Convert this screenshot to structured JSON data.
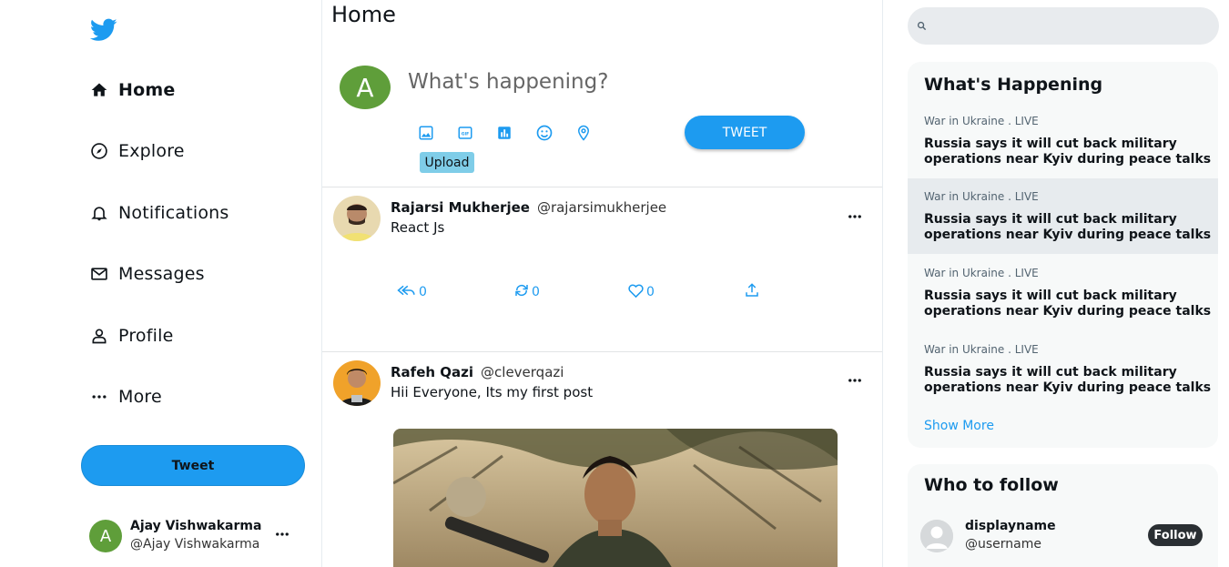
{
  "colors": {
    "accent": "#1d9bf0",
    "avatar_green": "#5f9e3a",
    "upload": "#7fcde8",
    "follow_btn": "#2a2f33"
  },
  "sidebar": {
    "logo_icon": "twitter-bird-icon",
    "items": [
      {
        "label": "Home",
        "icon": "home-icon",
        "active": true
      },
      {
        "label": "Explore",
        "icon": "compass-icon"
      },
      {
        "label": "Notifications",
        "icon": "bell-icon"
      },
      {
        "label": "Messages",
        "icon": "mail-icon"
      },
      {
        "label": "Profile",
        "icon": "person-icon"
      },
      {
        "label": "More",
        "icon": "more-dots-icon"
      }
    ],
    "tweet_label": "Tweet",
    "user": {
      "avatar_letter": "A",
      "name": "Ajay Vishwakarma",
      "handle": "@Ajay Vishwakarma"
    }
  },
  "feed": {
    "title": "Home",
    "composer": {
      "avatar_letter": "A",
      "placeholder": "What's happening?",
      "tools": [
        "image-icon",
        "gif-icon",
        "poll-icon",
        "emoji-icon",
        "location-icon"
      ],
      "upload_label": "Upload",
      "tweet_label": "TWEET"
    },
    "posts": [
      {
        "name": "Rajarsi Mukherjee",
        "handle": "@rajarsimukherjee",
        "text": "React Js",
        "replies": "0",
        "retweets": "0",
        "likes": "0"
      },
      {
        "name": "Rafeh Qazi",
        "handle": "@cleverqazi",
        "text": "Hii Everyone, Its my first post"
      }
    ]
  },
  "right": {
    "search_placeholder": "",
    "happening": {
      "title": "What's Happening",
      "trends": [
        {
          "meta": "War in Ukraine . LIVE",
          "headline": "Russia says it will cut back military operations near Kyiv during peace talks"
        },
        {
          "meta": "War in Ukraine . LIVE",
          "headline": "Russia says it will cut back military operations near Kyiv during peace talks"
        },
        {
          "meta": "War in Ukraine . LIVE",
          "headline": "Russia says it will cut back military operations near Kyiv during peace talks"
        },
        {
          "meta": "War in Ukraine . LIVE",
          "headline": "Russia says it will cut back military operations near Kyiv during peace talks"
        }
      ],
      "show_more": "Show More"
    },
    "who_to_follow": {
      "title": "Who to follow",
      "name": "displayname",
      "username": "@username",
      "follow_label": "Follow"
    }
  }
}
